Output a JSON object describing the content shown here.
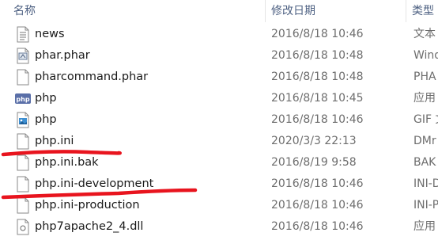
{
  "columns": {
    "name": "名称",
    "date": "修改日期",
    "type": "类型"
  },
  "files": [
    {
      "name": "news",
      "date": "2016/8/18 10:46",
      "type": "文本",
      "icon": "text-file-icon"
    },
    {
      "name": "phar.phar",
      "date": "2016/8/18 10:48",
      "type": "Wind",
      "icon": "phar-file-icon"
    },
    {
      "name": "pharcommand.phar",
      "date": "2016/8/18 10:48",
      "type": "PHA",
      "icon": "blank-file-icon"
    },
    {
      "name": "php",
      "date": "2016/8/18 10:45",
      "type": "应用",
      "icon": "php-exe-icon"
    },
    {
      "name": "php",
      "date": "2016/8/18 10:46",
      "type": "GIF 文",
      "icon": "image-file-icon"
    },
    {
      "name": "php.ini",
      "date": "2020/3/3 22:13",
      "type": "DMr",
      "icon": "blank-file-icon"
    },
    {
      "name": "php.ini.bak",
      "date": "2016/8/19 9:58",
      "type": "BAK",
      "icon": "blank-file-icon"
    },
    {
      "name": "php.ini-development",
      "date": "2016/8/18 10:46",
      "type": "INI-D",
      "icon": "blank-file-icon"
    },
    {
      "name": "php.ini-production",
      "date": "2016/8/18 10:46",
      "type": "INI-P",
      "icon": "blank-file-icon"
    },
    {
      "name": "php7apache2_4.dll",
      "date": "2016/8/18 10:46",
      "type": "应用",
      "icon": "dll-file-icon"
    }
  ],
  "annotation_color": "#e8141e"
}
